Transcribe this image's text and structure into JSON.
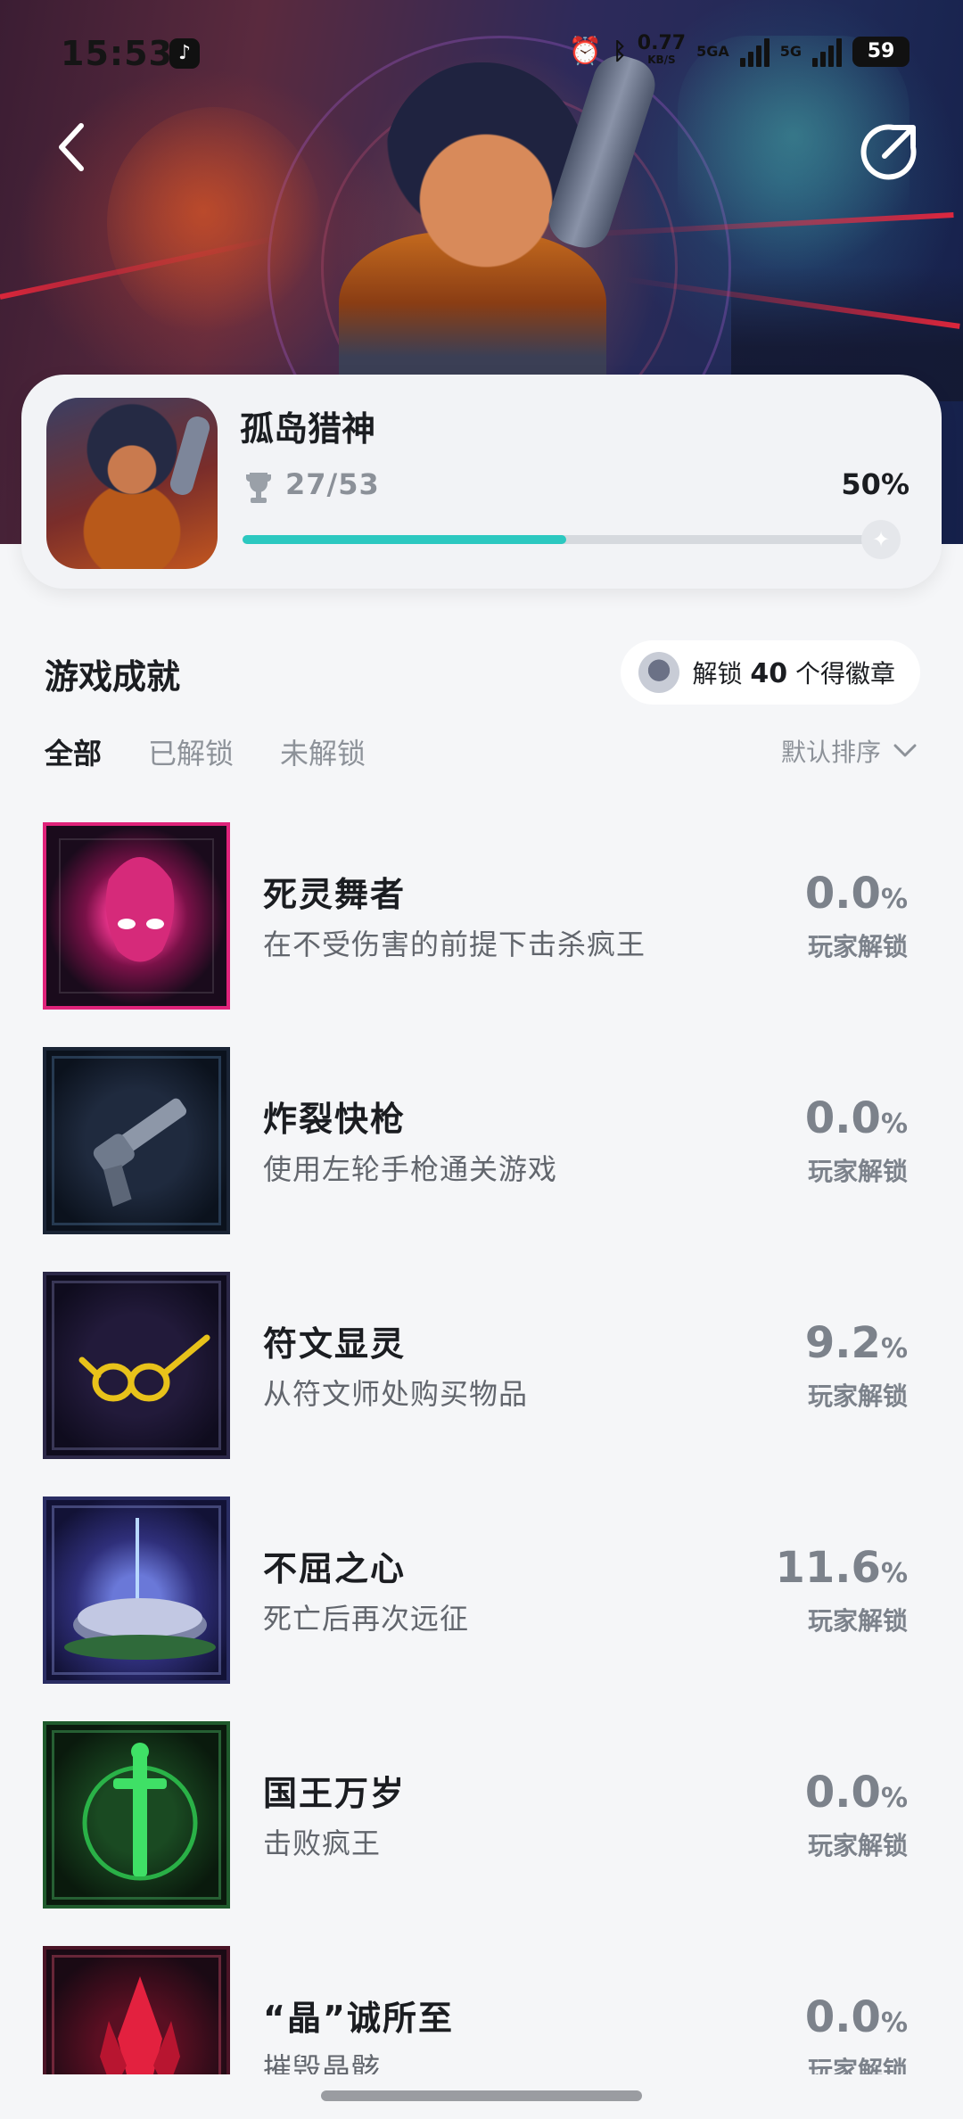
{
  "status_bar": {
    "time": "15:53",
    "network_speed_value": "0.77",
    "network_speed_unit": "KB/S",
    "signal1_label": "5GA",
    "signal2_label": "5G",
    "battery": "59"
  },
  "game": {
    "title": "孤岛猎神",
    "progress_count": "27/53",
    "progress_percent": "50%",
    "progress_fraction": 0.5
  },
  "achievements_section": {
    "title": "游戏成就",
    "badge_prefix": "解锁 ",
    "badge_count": "40",
    "badge_suffix": " 个得徽章"
  },
  "tabs": [
    {
      "label": "全部",
      "active": true
    },
    {
      "label": "已解锁",
      "active": false
    },
    {
      "label": "未解锁",
      "active": false
    }
  ],
  "sort_label": "默认排序",
  "achievements": [
    {
      "name": "死灵舞者",
      "desc": "在不受伤害的前提下击杀疯王",
      "pct": "0.0",
      "label": "玩家解锁",
      "icon": "necro-dancer-icon",
      "color": "#e0237a"
    },
    {
      "name": "炸裂快枪",
      "desc": "使用左轮手枪通关游戏",
      "pct": "0.0",
      "label": "玩家解锁",
      "icon": "revolver-icon",
      "color": "#3f5a78"
    },
    {
      "name": "符文显灵",
      "desc": "从符文师处购买物品",
      "pct": "9.2",
      "label": "玩家解锁",
      "icon": "glasses-icon",
      "color": "#5a5f8a"
    },
    {
      "name": "不屈之心",
      "desc": "死亡后再次远征",
      "pct": "11.6",
      "label": "玩家解锁",
      "icon": "altar-icon",
      "color": "#4b63a8"
    },
    {
      "name": "国王万岁",
      "desc": "击败疯王",
      "pct": "0.0",
      "label": "玩家解锁",
      "icon": "sword-icon",
      "color": "#2fb84a"
    },
    {
      "name": "“晶”诚所至",
      "desc": "摧毁晶骸",
      "pct": "0.0",
      "label": "玩家解锁",
      "icon": "crystal-icon",
      "color": "#c2183a"
    }
  ],
  "percent_sign": "%"
}
